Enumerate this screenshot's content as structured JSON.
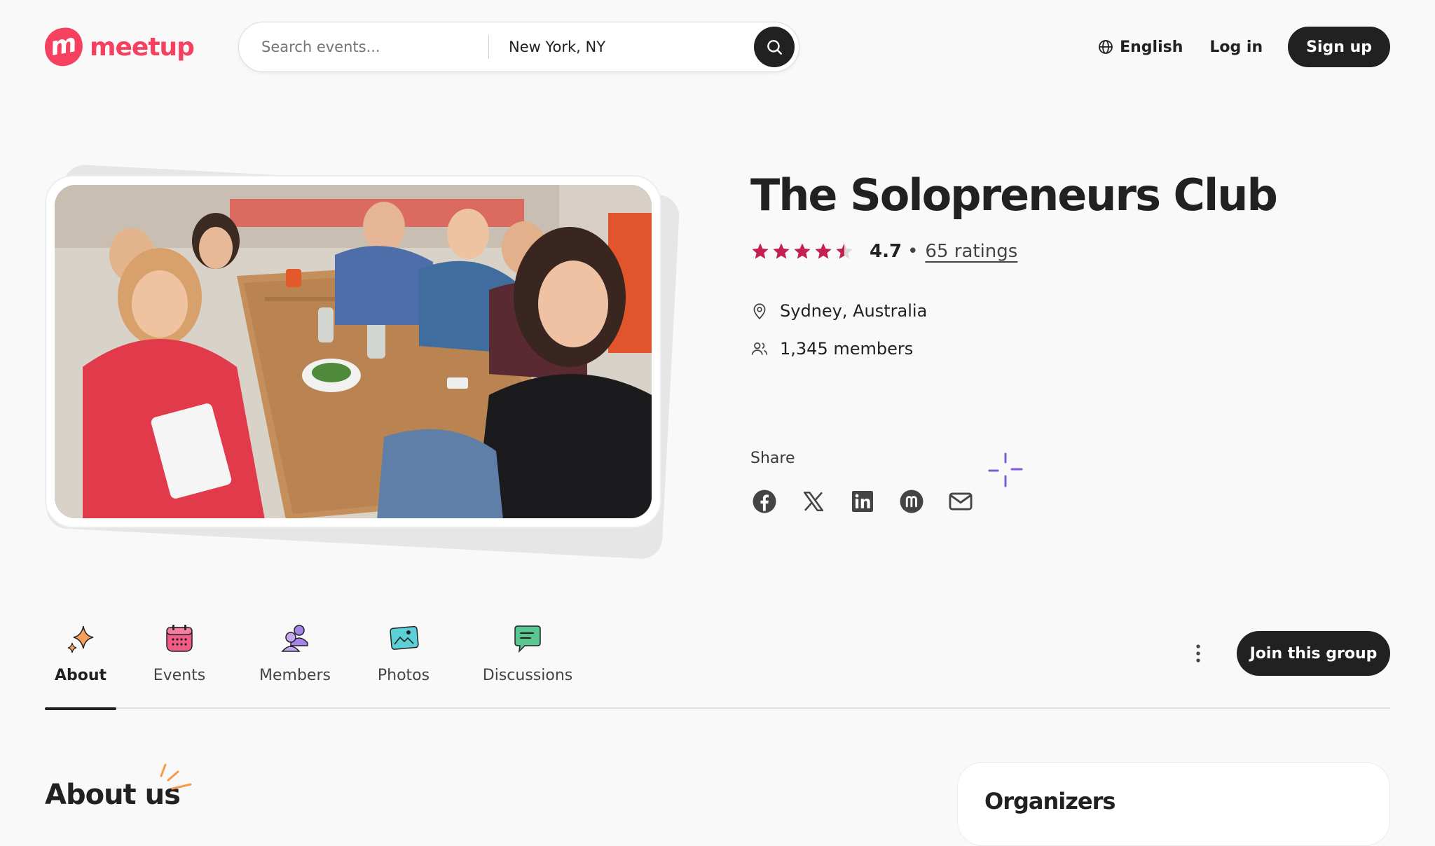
{
  "header": {
    "logo_text": "meetup",
    "logo_mark": "m",
    "search": {
      "events_placeholder": "Search events...",
      "location_value": "New York, NY",
      "search_icon": "search-icon"
    },
    "language_label": "English",
    "login_label": "Log in",
    "signup_label": "Sign up"
  },
  "group": {
    "name": "The Solopreneurs Club",
    "rating_value": "4.7",
    "rating_stars": 4.7,
    "rating_separator": "•",
    "rating_count": "65 ratings",
    "location": "Sydney, Australia",
    "members": "1,345 members",
    "share_label": "Share",
    "share_icons": [
      "facebook-icon",
      "x-icon",
      "linkedin-icon",
      "meetup-icon",
      "email-icon"
    ]
  },
  "tabs": [
    {
      "label": "About",
      "icon": "sparkle-icon",
      "active": true
    },
    {
      "label": "Events",
      "icon": "calendar-icon",
      "active": false
    },
    {
      "label": "Members",
      "icon": "people-icon",
      "active": false
    },
    {
      "label": "Photos",
      "icon": "photo-icon",
      "active": false
    },
    {
      "label": "Discussions",
      "icon": "chat-bubble-icon",
      "active": false
    }
  ],
  "actions": {
    "join_label": "Join this group",
    "more_icon": "more-vertical-icon"
  },
  "sections": {
    "about_heading": "About us",
    "organizers_heading": "Organizers"
  },
  "colors": {
    "brand": "#f64060",
    "star": "#c4204f",
    "dark": "#212121"
  }
}
